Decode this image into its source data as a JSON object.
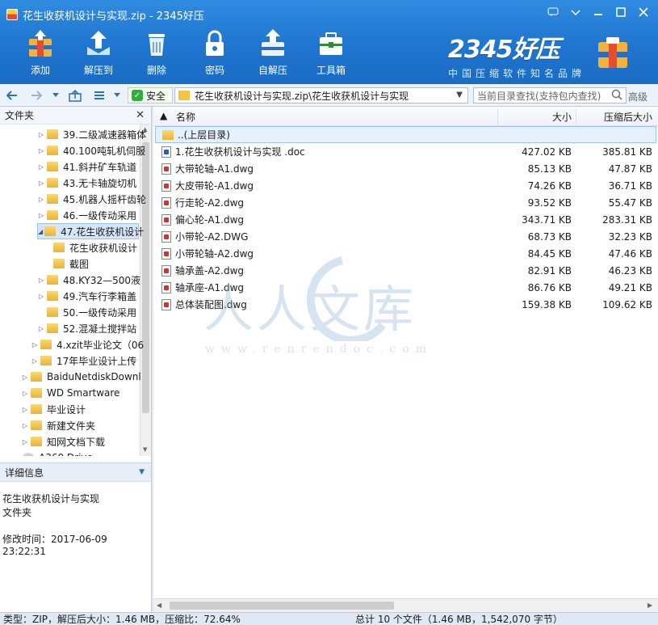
{
  "window": {
    "title": "花生收获机设计与实现.zip - 2345好压",
    "controls": [
      "chat-icon",
      "menu-icon",
      "minimize-icon",
      "maximize-icon",
      "close-icon"
    ]
  },
  "toolbar": {
    "add": "添加",
    "extract_to": "解压到",
    "delete": "删除",
    "password": "密码",
    "self_extract": "自解压",
    "toolbox": "工具箱"
  },
  "brand": {
    "name": "2345好压",
    "slogan": "中国压缩软件知名品牌"
  },
  "address": {
    "safe_label": "安全",
    "path": "花生收获机设计与实现.zip\\花生收获机设计与实现",
    "search_placeholder": "当前目录查找(支持包内查找)",
    "advanced": "高级"
  },
  "tree": {
    "header": "文件夹",
    "items": [
      {
        "label": "39.二级减速器箱体",
        "indent": 2,
        "expand": "▷"
      },
      {
        "label": "40.100吨轧机伺服",
        "indent": 2,
        "expand": "▷"
      },
      {
        "label": "41.斜井矿车轨道",
        "indent": 2,
        "expand": "▷"
      },
      {
        "label": "43.无卡轴旋切机",
        "indent": 2,
        "expand": "▷"
      },
      {
        "label": "45.机器人摇杆齿轮",
        "indent": 2,
        "expand": "▷"
      },
      {
        "label": "46.一级传动采用",
        "indent": 2,
        "expand": "▷"
      },
      {
        "label": "47.花生收获机设计",
        "indent": 2,
        "expand": "◢",
        "selected": true
      },
      {
        "label": "花生收获机设计",
        "indent": 3,
        "expand": ""
      },
      {
        "label": "截图",
        "indent": 3,
        "expand": ""
      },
      {
        "label": "48.KY32—500液",
        "indent": 2,
        "expand": "▷"
      },
      {
        "label": "49.汽车行李箱盖",
        "indent": 2,
        "expand": "▷"
      },
      {
        "label": "50.一级传动采用",
        "indent": 2,
        "expand": ""
      },
      {
        "label": "52.混凝土搅拌站",
        "indent": 2,
        "expand": "▷"
      },
      {
        "label": "4.xzit毕业论文（06",
        "indent": 1,
        "expand": "▷"
      },
      {
        "label": "17年毕业设计上传",
        "indent": 1,
        "expand": "▷"
      },
      {
        "label": "BaiduNetdiskDownl",
        "indent": 0,
        "expand": "▷"
      },
      {
        "label": "WD Smartware",
        "indent": 0,
        "expand": "▷"
      },
      {
        "label": "毕业设计",
        "indent": 0,
        "expand": "▷"
      },
      {
        "label": "新建文件夹",
        "indent": 0,
        "expand": "▷"
      },
      {
        "label": "知网文档下载",
        "indent": 0,
        "expand": "▷"
      },
      {
        "label": "A360 Drive",
        "indent": -1,
        "expand": "▷"
      }
    ]
  },
  "details": {
    "header": "详细信息",
    "name": "花生收获机设计与实现",
    "type": "文件夹",
    "modified": "修改时间：2017-06-09 23:22:31"
  },
  "columns": {
    "name": "名称",
    "size": "大小",
    "compressed": "压缩后大小"
  },
  "files": [
    {
      "name": "..(上层目录)",
      "kind": "folder",
      "size": "",
      "compressed": ""
    },
    {
      "name": "1.花生收获机设计与实现 .doc",
      "kind": "doc",
      "size": "427.02 KB",
      "compressed": "385.81 KB"
    },
    {
      "name": "大带轮轴-A1.dwg",
      "kind": "dwg",
      "size": "85.13 KB",
      "compressed": "47.87 KB"
    },
    {
      "name": "大皮带轮-A1.dwg",
      "kind": "dwg",
      "size": "74.26 KB",
      "compressed": "36.71 KB"
    },
    {
      "name": "行走轮-A2.dwg",
      "kind": "dwg",
      "size": "93.52 KB",
      "compressed": "55.47 KB"
    },
    {
      "name": "偏心轮-A1.dwg",
      "kind": "dwg",
      "size": "343.71 KB",
      "compressed": "283.31 KB"
    },
    {
      "name": "小带轮-A2.DWG",
      "kind": "dwg",
      "size": "68.73 KB",
      "compressed": "32.23 KB"
    },
    {
      "name": "小带轮轴-A2.dwg",
      "kind": "dwg",
      "size": "84.45 KB",
      "compressed": "47.46 KB"
    },
    {
      "name": "轴承盖-A2.dwg",
      "kind": "dwg",
      "size": "82.91 KB",
      "compressed": "46.23 KB"
    },
    {
      "name": "轴承座-A1.dwg",
      "kind": "dwg",
      "size": "86.76 KB",
      "compressed": "49.21 KB"
    },
    {
      "name": "总体装配图.dwg",
      "kind": "dwg",
      "size": "159.38 KB",
      "compressed": "109.62 KB"
    }
  ],
  "watermark": {
    "text": "人人文库",
    "url": "www.renrendoc.com"
  },
  "status": {
    "left": "类型：ZIP，解压后大小：1.46 MB，压缩比：72.64%",
    "right": "总计 10 个文件（1.46 MB，1,542,070 字节）"
  },
  "colors": {
    "title_bar": "#1f75cf",
    "selection": "#d5e6fa",
    "folder": "#f2c442"
  }
}
